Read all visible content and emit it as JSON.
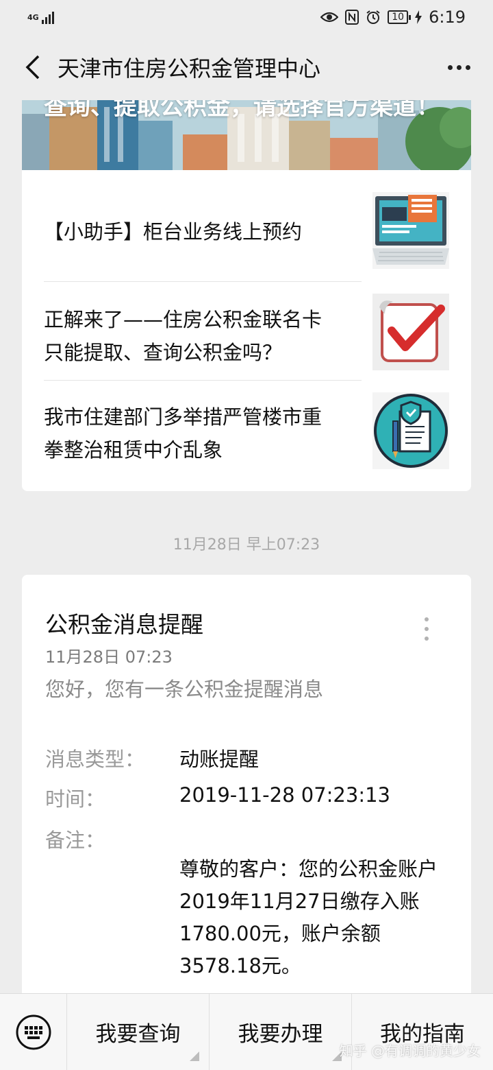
{
  "status_bar": {
    "network": "4G",
    "battery": "10",
    "time": "6:19"
  },
  "nav": {
    "title": "天津市住房公积金管理中心"
  },
  "articles": {
    "banner_text": "查询、提取公积金，请选择官方渠道！",
    "items": [
      {
        "title": "【小助手】柜台业务线上预约"
      },
      {
        "title": "正解来了——住房公积金联名卡只能提取、查询公积金吗？"
      },
      {
        "title": "我市住建部门多举措严管楼市重拳整治租赁中介乱象"
      }
    ]
  },
  "timestamp": "11月28日 早上07:23",
  "message": {
    "title": "公积金消息提醒",
    "date": "11月28日  07:23",
    "intro": "您好，您有一条公积金提醒消息",
    "fields": {
      "type_label": "消息类型：",
      "type_value": "动账提醒",
      "time_label": "时间：",
      "time_value": "2019-11-28 07:23:13",
      "remark_label": "备注：",
      "remark_value": "尊敬的客户：您的公积金账户2019年11月27日缴存入账1780.00元，账户余额3578.18元。"
    }
  },
  "bottom_menu": {
    "items": [
      "我要查询",
      "我要办理",
      "我的指南"
    ]
  },
  "watermark": "知乎 @有调调的黄少女"
}
